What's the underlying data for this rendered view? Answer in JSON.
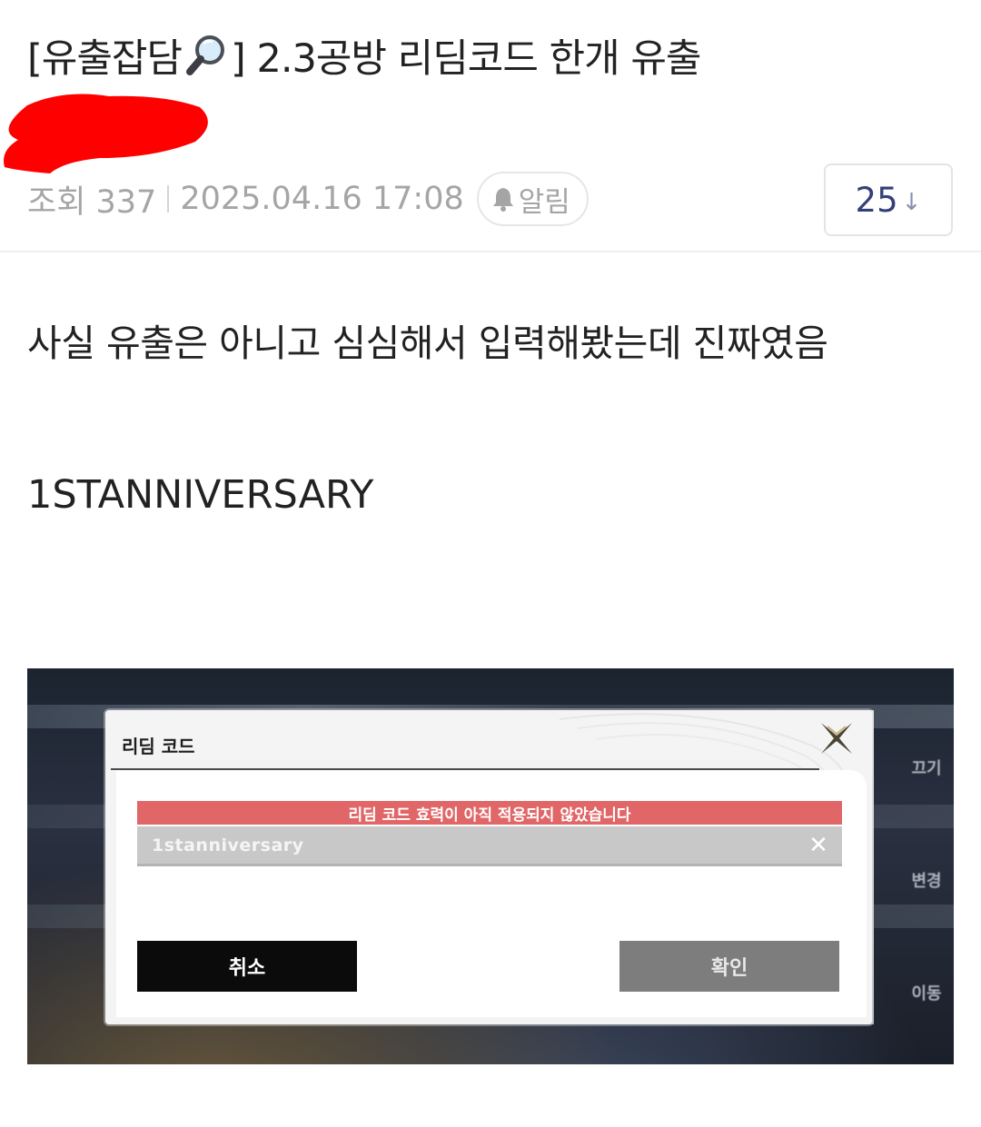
{
  "post": {
    "title_prefix": "[유출잡담",
    "title_icon": "magnifier-icon",
    "title_suffix": "] 2.3공방 리딤코드 한개 유출",
    "author_redaction_color": "#ff0000",
    "views": "조회 337",
    "datetime": "2025.04.16 17:08",
    "alarm_label": "알림",
    "comment_count": "25",
    "comment_arrow": "↓"
  },
  "body": {
    "line1": "사실 유출은 아니고 심심해서 입력해봤는데 진짜였음",
    "line2": "1STANNIVERSARY"
  },
  "game_screenshot": {
    "dialog_title": "리딤 코드",
    "error_message": "리딤 코드 효력이 아직 적용되지 않았습니다",
    "input_value": "1stanniversary",
    "clear_label": "✕",
    "cancel_label": "취소",
    "confirm_label": "확인",
    "side_labels": [
      "끄기",
      "변경",
      "이동"
    ],
    "colors": {
      "error_banner": "#e16667",
      "cancel_button": "#0b0b0b",
      "confirm_button": "#7d7d7d"
    }
  }
}
